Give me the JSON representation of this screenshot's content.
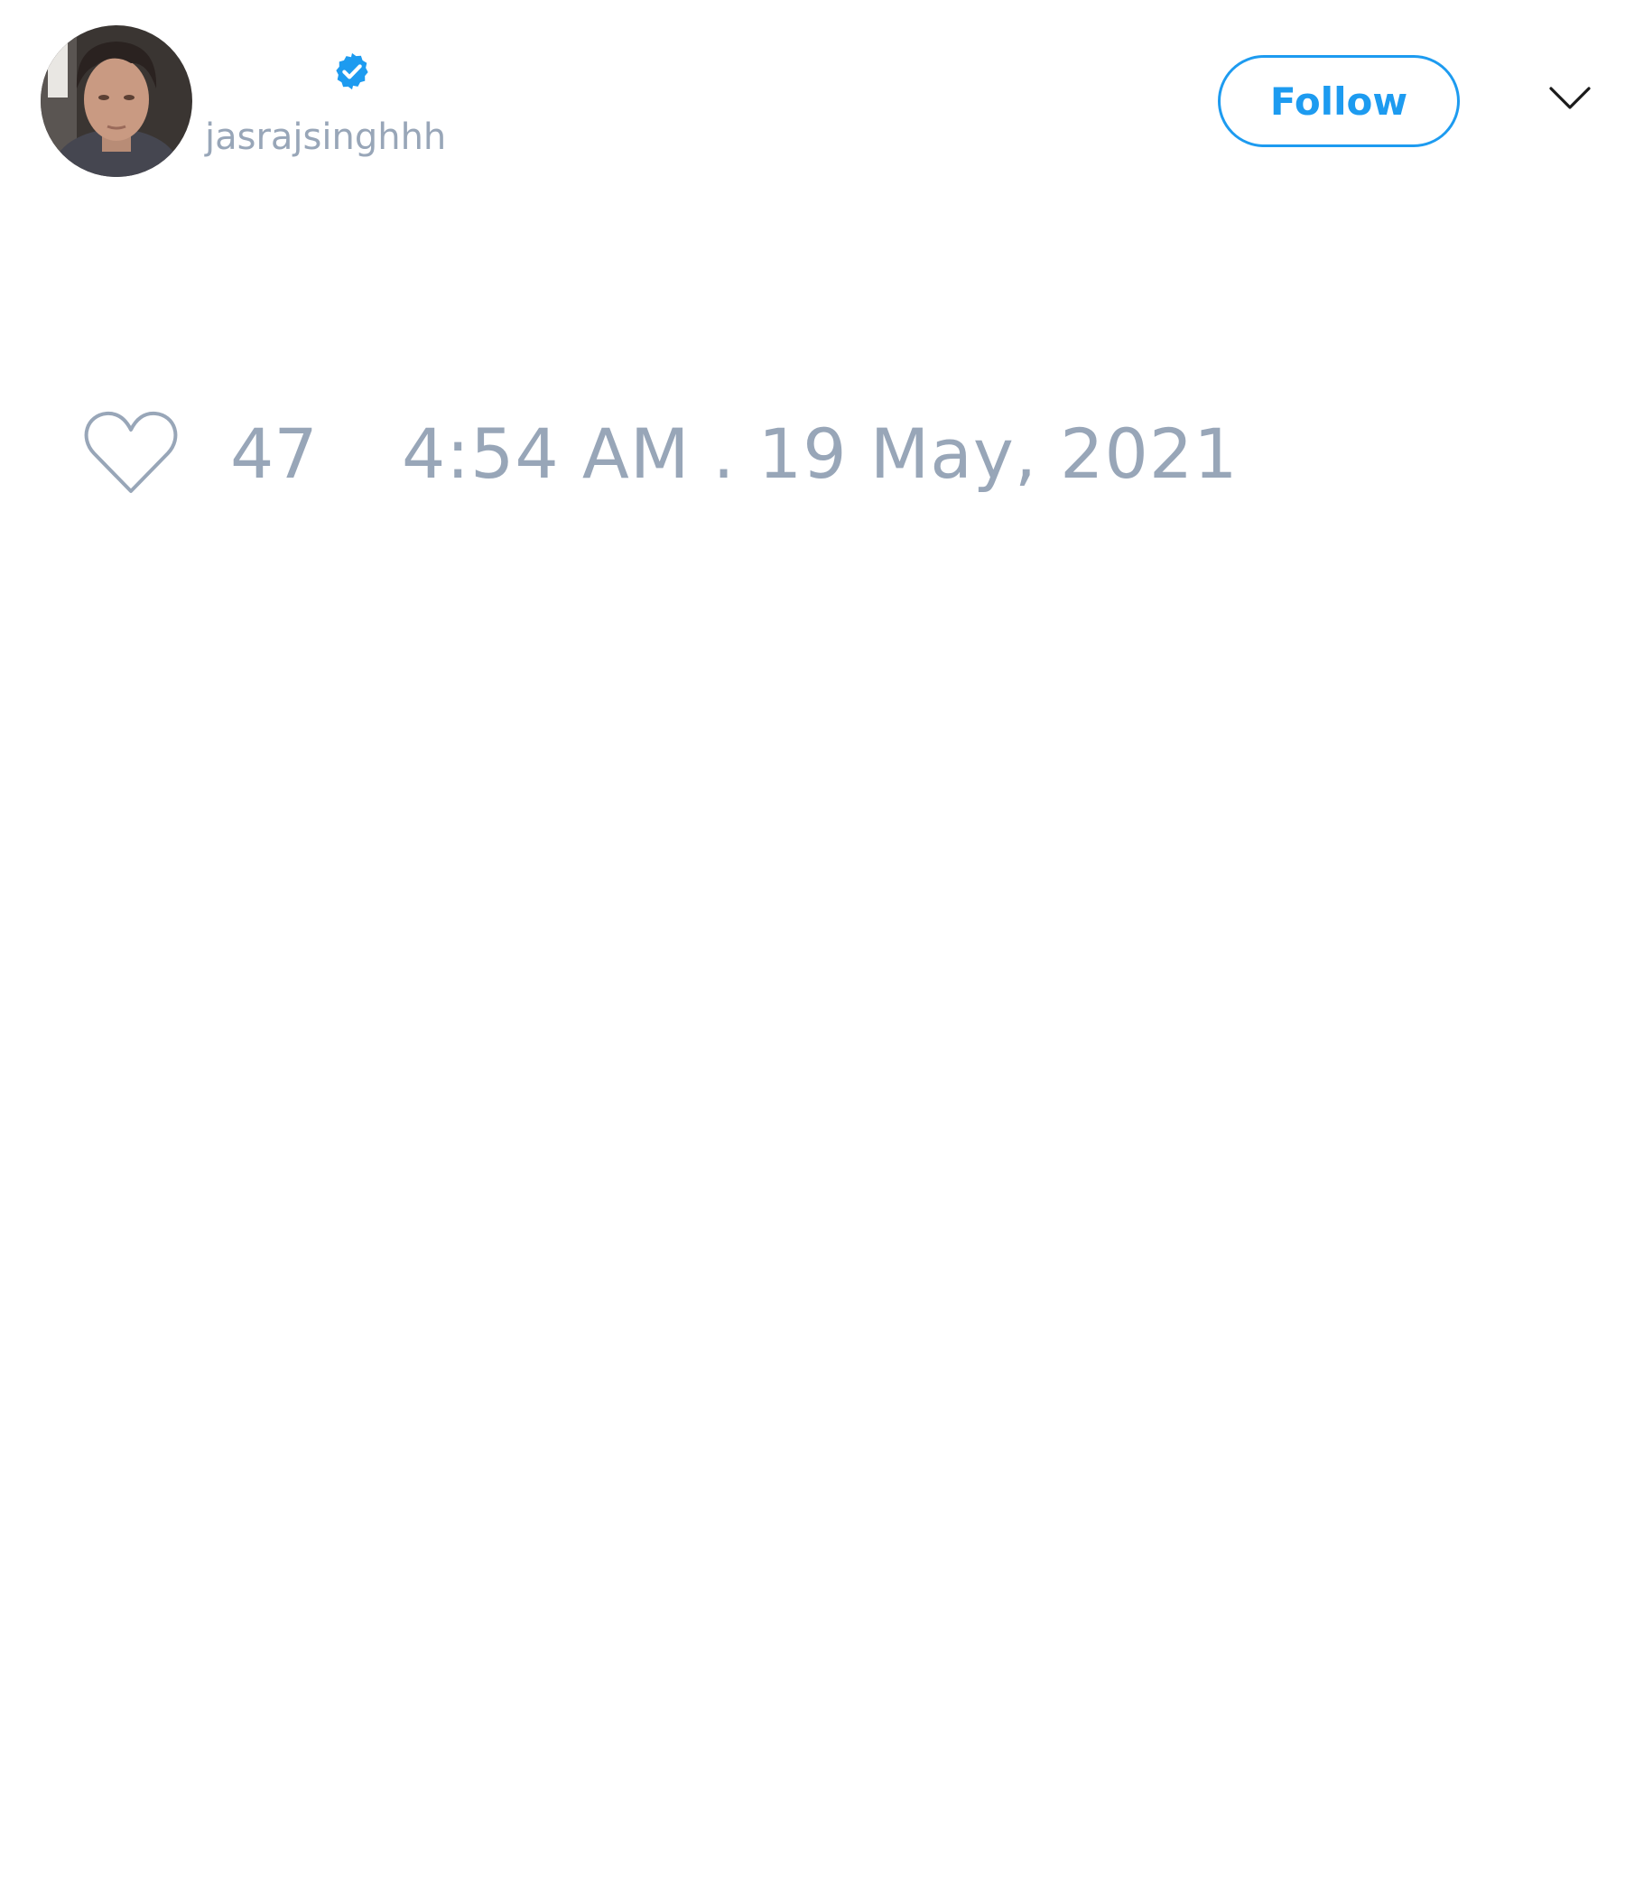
{
  "user": {
    "handle": "jasrajsinghhh",
    "avatar": "user-avatar-photo",
    "verified_icon": "verified-badge-icon"
  },
  "actions": {
    "follow_label": "Follow",
    "menu_icon": "chevron-down-icon"
  },
  "tweet": {
    "likes": "47",
    "timestamp": "4:54 AM . 19 May, 2021",
    "like_icon": "heart-icon"
  },
  "colors": {
    "accent": "#1d9bf0",
    "muted_text": "#98a6b8",
    "icon_stroke": "#98a6b8",
    "background": "#ffffff"
  }
}
